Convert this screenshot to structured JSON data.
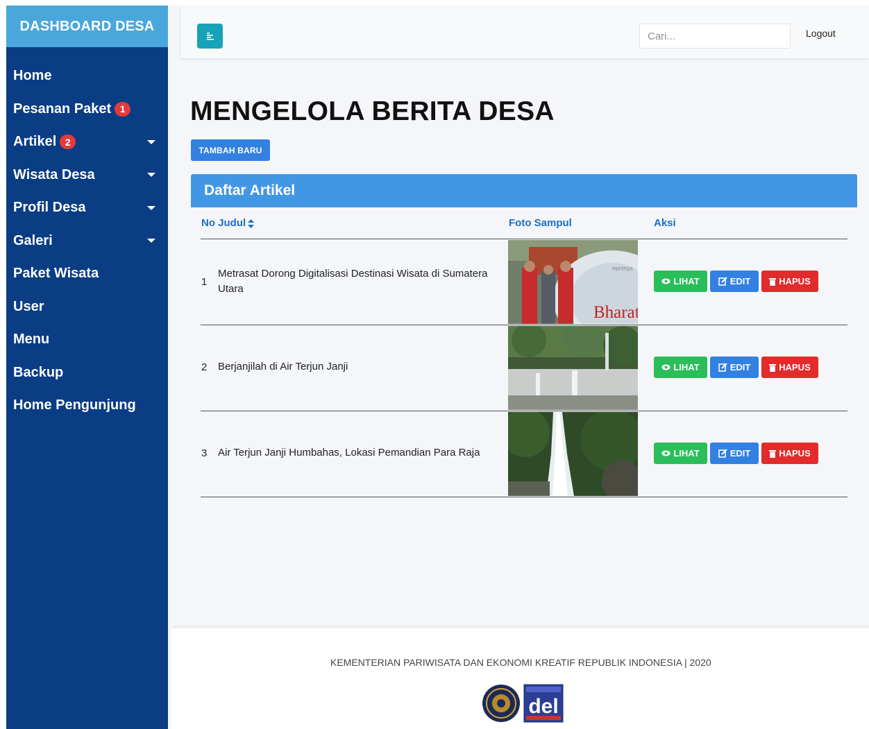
{
  "sidebar": {
    "brand": "DASHBOARD DESA",
    "items": [
      {
        "label": "Home",
        "badge": "",
        "caret": false
      },
      {
        "label": "Pesanan Paket",
        "badge": "1",
        "caret": false
      },
      {
        "label": "Artikel",
        "badge": "2",
        "caret": true
      },
      {
        "label": "Wisata Desa",
        "badge": "",
        "caret": true
      },
      {
        "label": "Profil Desa",
        "badge": "",
        "caret": true
      },
      {
        "label": "Galeri",
        "badge": "",
        "caret": true
      },
      {
        "label": "Paket Wisata",
        "badge": "",
        "caret": false
      },
      {
        "label": "User",
        "badge": "",
        "caret": false
      },
      {
        "label": "Menu",
        "badge": "",
        "caret": false
      },
      {
        "label": "Backup",
        "badge": "",
        "caret": false
      },
      {
        "label": "Home Pengunjung",
        "badge": "",
        "caret": false
      }
    ]
  },
  "topbar": {
    "search_placeholder": "Cari...",
    "logout_label": "Logout"
  },
  "page": {
    "title": "MENGELOLA BERITA DESA",
    "add_button": "TAMBAH BARU"
  },
  "table": {
    "card_title": "Daftar Artikel",
    "columns": [
      "No Judul",
      "Foto Sampul",
      "Aksi"
    ],
    "rows": [
      {
        "no": "1",
        "title": "Metrasat Dorong Digitalisasi Destinasi Wisata di Sumatera Utara"
      },
      {
        "no": "2",
        "title": "Berjanjilah di Air Terjun Janji"
      },
      {
        "no": "3",
        "title": "Air Terjun Janji Humbahas, Lokasi Pemandian Para Raja"
      }
    ],
    "actions": {
      "view": "LIHAT",
      "edit": "EDIT",
      "delete": "HAPUS"
    },
    "photo_captions": {
      "brand_small": "metras",
      "brand_big": "Bharat"
    }
  },
  "footer": {
    "text": "KEMENTERIAN PARIWISATA DAN EKONOMI KREATIF REPUBLIK INDONESIA | 2020",
    "logo_text": "del"
  },
  "colors": {
    "sidebar": "#0a3d84",
    "brand": "#49a7dc",
    "primary": "#3280e0",
    "success": "#2bbd5a",
    "danger": "#e22b2b",
    "info": "#17a2b8"
  }
}
